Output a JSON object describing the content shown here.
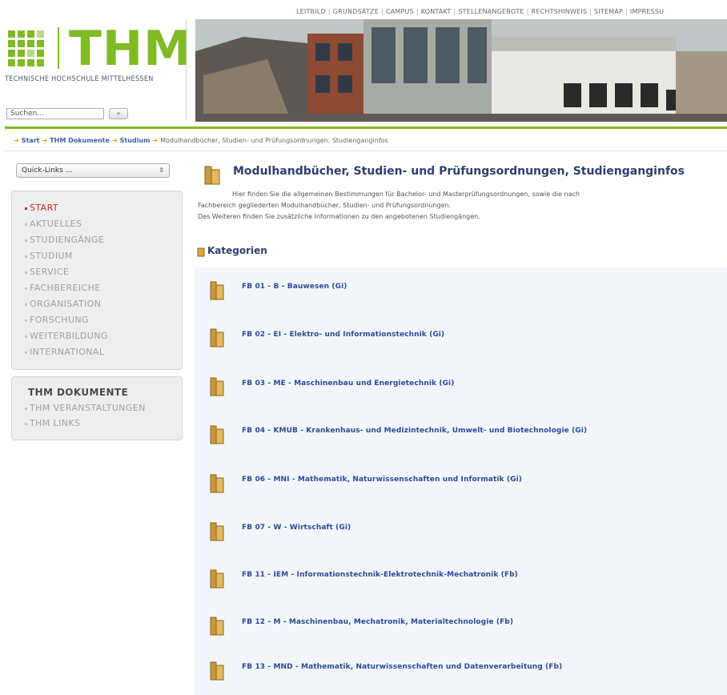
{
  "top_nav": [
    "LEITBILD",
    "GRUNDSÄTZE",
    "CAMPUS",
    "KONTAKT",
    "STELLENANGEBOTE",
    "RECHTSHINWEIS",
    "SITEMAP",
    "IMPRESSU"
  ],
  "logo": {
    "text": "THM",
    "subtitle": "TECHNISCHE HOCHSCHULE MITTELHESSEN"
  },
  "search": {
    "placeholder": "Suchen...",
    "button": "»"
  },
  "breadcrumb": {
    "items": [
      "Start",
      "THM Dokumente",
      "Studium"
    ],
    "current": "Modulhandbücher, Studien- und Prüfungsordnungen, Studienganginfos"
  },
  "sidebar": {
    "quick_links": "Quick-Links ...",
    "menu": [
      "START",
      "AKTUELLES",
      "STUDIENGÄNGE",
      "STUDIUM",
      "SERVICE",
      "FACHBEREICHE",
      "ORGANISATION",
      "FORSCHUNG",
      "WEITERBILDUNG",
      "INTERNATIONAL"
    ],
    "active_item": "START",
    "menu2_title": "THM DOKUMENTE",
    "menu2": [
      "THM VERANSTALTUNGEN",
      "THM LINKS"
    ]
  },
  "main": {
    "title": "Modulhandbücher, Studien- und Prüfungsordnungen, Studienganginfos",
    "intro_lines": [
      "Hier finden Sie die allgemeinen Bestimmungen für Bachelor- und Masterprüfungsordnungen, sowie die nach",
      "Fachbereich gegliederten Modulhandbücher, Studien- und Prüfungsordnungen.",
      "Des Weiteren finden Sie zusätzliche Informationen zu den angebotenen Studiengängen."
    ],
    "categories_label": "Kategorien",
    "categories": [
      "FB 01 - B - Bauwesen (Gi)",
      "FB 02 - EI - Elektro- und Informationstechnik (Gi)",
      "FB 03 - ME - Maschinenbau und Energietechnik (Gi)",
      "FB 04 - KMUB - Krankenhaus- und Medizintechnik, Umwelt- und Biotechnologie (Gi)",
      "FB 06 - MNI - Mathematik, Naturwissenschaften und Informatik (Gi)",
      "FB 07 - W - Wirtschaft (Gi)",
      "FB 11 - IEM - Informationstechnik-Elektrotechnik-Mechatronik (Fb)",
      "FB 12 - M - Maschinenbau, Mechatronik, Materialtechnologie (Fb)",
      "FB 13 - MND - Mathematik, Naturwissenschaften und Datenverarbeitung (Fb)"
    ]
  },
  "colors": {
    "brand_green": "#80ba24",
    "link_blue": "#2e4a95",
    "title_blue": "#2e3f6f",
    "active_red": "#c62b2b"
  }
}
